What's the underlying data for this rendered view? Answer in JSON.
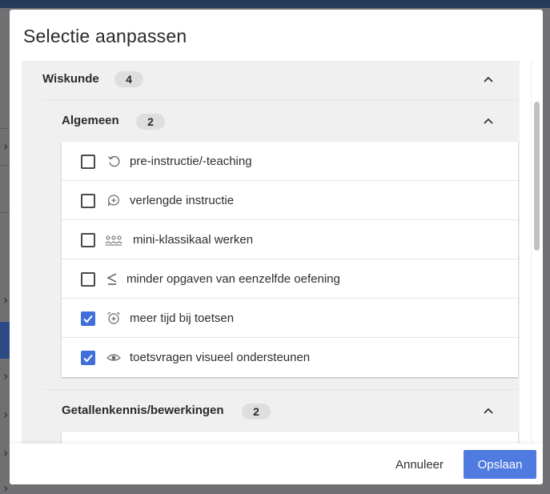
{
  "dialog": {
    "title": "Selectie aanpassen",
    "accent_color": "#4f7ae0",
    "checkbox_color": "#3f6fd8"
  },
  "subject": {
    "label": "Wiskunde",
    "count": "4",
    "expanded": true
  },
  "groups": [
    {
      "label": "Algemeen",
      "count": "2",
      "expanded": true,
      "items": [
        {
          "label": "pre-instructie/-teaching",
          "icon": "undo-icon",
          "checked": false
        },
        {
          "label": "verlengde instructie",
          "icon": "speech-plus-icon",
          "checked": false
        },
        {
          "label": "mini-klassikaal werken",
          "icon": "group-icon",
          "checked": false
        },
        {
          "label": "minder opgaven van eenzelfde oefening",
          "icon": "less-equal-icon",
          "checked": false
        },
        {
          "label": "meer tijd bij toetsen",
          "icon": "alarm-plus-icon",
          "checked": true
        },
        {
          "label": "toetsvragen visueel ondersteunen",
          "icon": "eye-icon",
          "checked": true
        }
      ]
    },
    {
      "label": "Getallenkennis/bewerkingen",
      "count": "2",
      "expanded": true
    }
  ],
  "footer": {
    "cancel_label": "Annuleer",
    "save_label": "Opslaan"
  }
}
